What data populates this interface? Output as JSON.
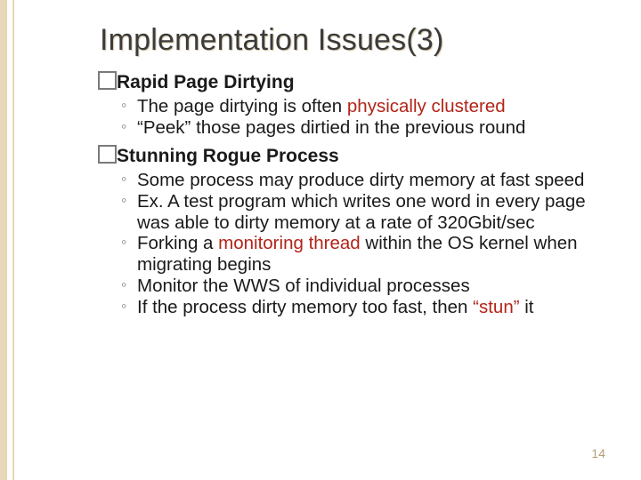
{
  "title": "Implementation Issues(3)",
  "sections": [
    {
      "label": "Rapid Page Dirtying",
      "bullets_html": [
        "The page dirtying is often <span class=\"hl\">physically clustered</span>",
        "“Peek” those pages dirtied in the previous round"
      ]
    },
    {
      "label": "Stunning Rogue Process",
      "bullets_html": [
        "Some process may produce dirty memory at fast speed",
        "Ex. A test program which writes one word in every page was able to dirty memory at a rate of 320Gbit/sec",
        "Forking a <span class=\"hl\">monitoring thread</span> within the OS kernel when migrating begins",
        "Monitor the WWS of individual processes",
        "If the process dirty memory too fast, then <span class=\"hl\">“stun”</span> it"
      ]
    }
  ],
  "page_number": "14"
}
